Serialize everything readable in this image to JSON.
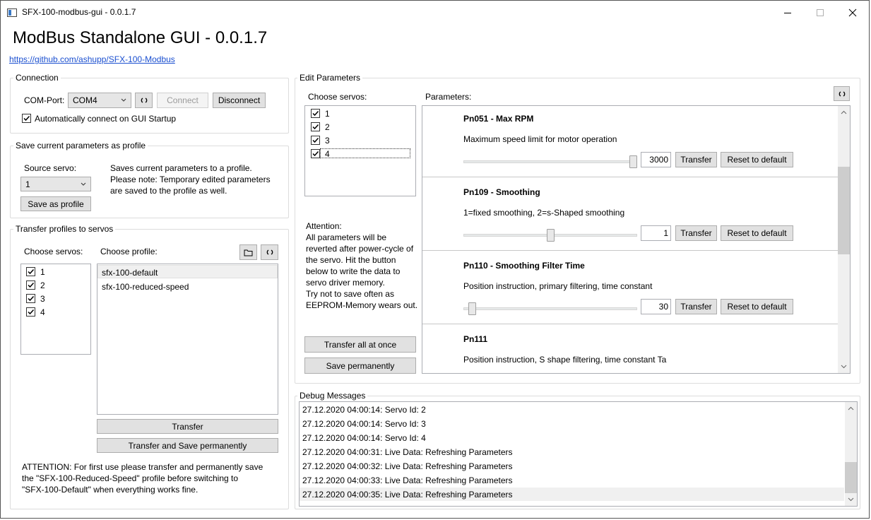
{
  "window": {
    "title": "SFX-100-modbus-gui - 0.0.1.7"
  },
  "header": {
    "title": "ModBus Standalone GUI - 0.0.1.7",
    "link": "https://github.com/ashupp/SFX-100-Modbus"
  },
  "connection": {
    "legend": "Connection",
    "com_label": "COM-Port:",
    "com_value": "COM4",
    "connect_label": "Connect",
    "disconnect_label": "Disconnect",
    "auto_connect_label": "Automatically connect on GUI Startup",
    "auto_connect_checked": true
  },
  "save_profile": {
    "legend": "Save current parameters as profile",
    "source_label": "Source servo:",
    "source_value": "1",
    "save_button": "Save as profile",
    "note_line1": "Saves current parameters to a profile.",
    "note_line2": "Please note: Temporary edited parameters",
    "note_line3": "are saved to the profile as well."
  },
  "transfer_profiles": {
    "legend": "Transfer profiles to servos",
    "choose_servos_label": "Choose servos:",
    "choose_profile_label": "Choose profile:",
    "servos": [
      "1",
      "2",
      "3",
      "4"
    ],
    "profiles": [
      "sfx-100-default",
      "sfx-100-reduced-speed"
    ],
    "transfer_button": "Transfer",
    "transfer_save_button": "Transfer and Save permanently",
    "attention_line1": "ATTENTION: For first use please transfer and permanently save",
    "attention_line2": "the \"SFX-100-Reduced-Speed\" profile before switching to",
    "attention_line3": "\"SFX-100-Default\" when everything works fine."
  },
  "edit_parameters": {
    "legend": "Edit Parameters",
    "choose_servos_label": "Choose servos:",
    "servos": [
      "1",
      "2",
      "3",
      "4"
    ],
    "parameters_label": "Parameters:",
    "attention": [
      "Attention:",
      "All parameters will be",
      "reverted after power-cycle of",
      "the servo. Hit the button",
      "below to write the data to",
      "servo driver memory.",
      "Try not to save often as",
      "EEPROM-Memory wears out."
    ],
    "transfer_all_button": "Transfer all at once",
    "save_perm_button": "Save permanently",
    "params": [
      {
        "name": "Pn051 - Max RPM",
        "desc": "Maximum speed limit for motor operation",
        "value": "3000",
        "level": 1.0
      },
      {
        "name": "Pn109 - Smoothing",
        "desc": "1=fixed smoothing, 2=s-Shaped smoothing",
        "value": "1",
        "level": 0.5
      },
      {
        "name": "Pn110 - Smoothing Filter Time",
        "desc": "Position instruction, primary filtering, time constant",
        "value": "30",
        "level": 0.03
      },
      {
        "name": "Pn111",
        "desc": "Position instruction, S shape filtering, time constant Ta",
        "value": "",
        "level": 0
      }
    ],
    "transfer_label": "Transfer",
    "reset_label": "Reset to default"
  },
  "debug": {
    "legend": "Debug Messages",
    "lines": [
      "27.12.2020 04:00:14: Servo Id: 2",
      "27.12.2020 04:00:14: Servo Id: 3",
      "27.12.2020 04:00:14: Servo Id: 4",
      "27.12.2020 04:00:31: Live Data: Refreshing Parameters",
      "27.12.2020 04:00:32: Live Data: Refreshing Parameters",
      "27.12.2020 04:00:33: Live Data: Refreshing Parameters",
      "27.12.2020 04:00:35: Live Data: Refreshing Parameters"
    ]
  },
  "colors": {
    "link": "#1a4fd0",
    "button_bg": "#e1e1e1",
    "group_border": "#dcdcdc"
  }
}
